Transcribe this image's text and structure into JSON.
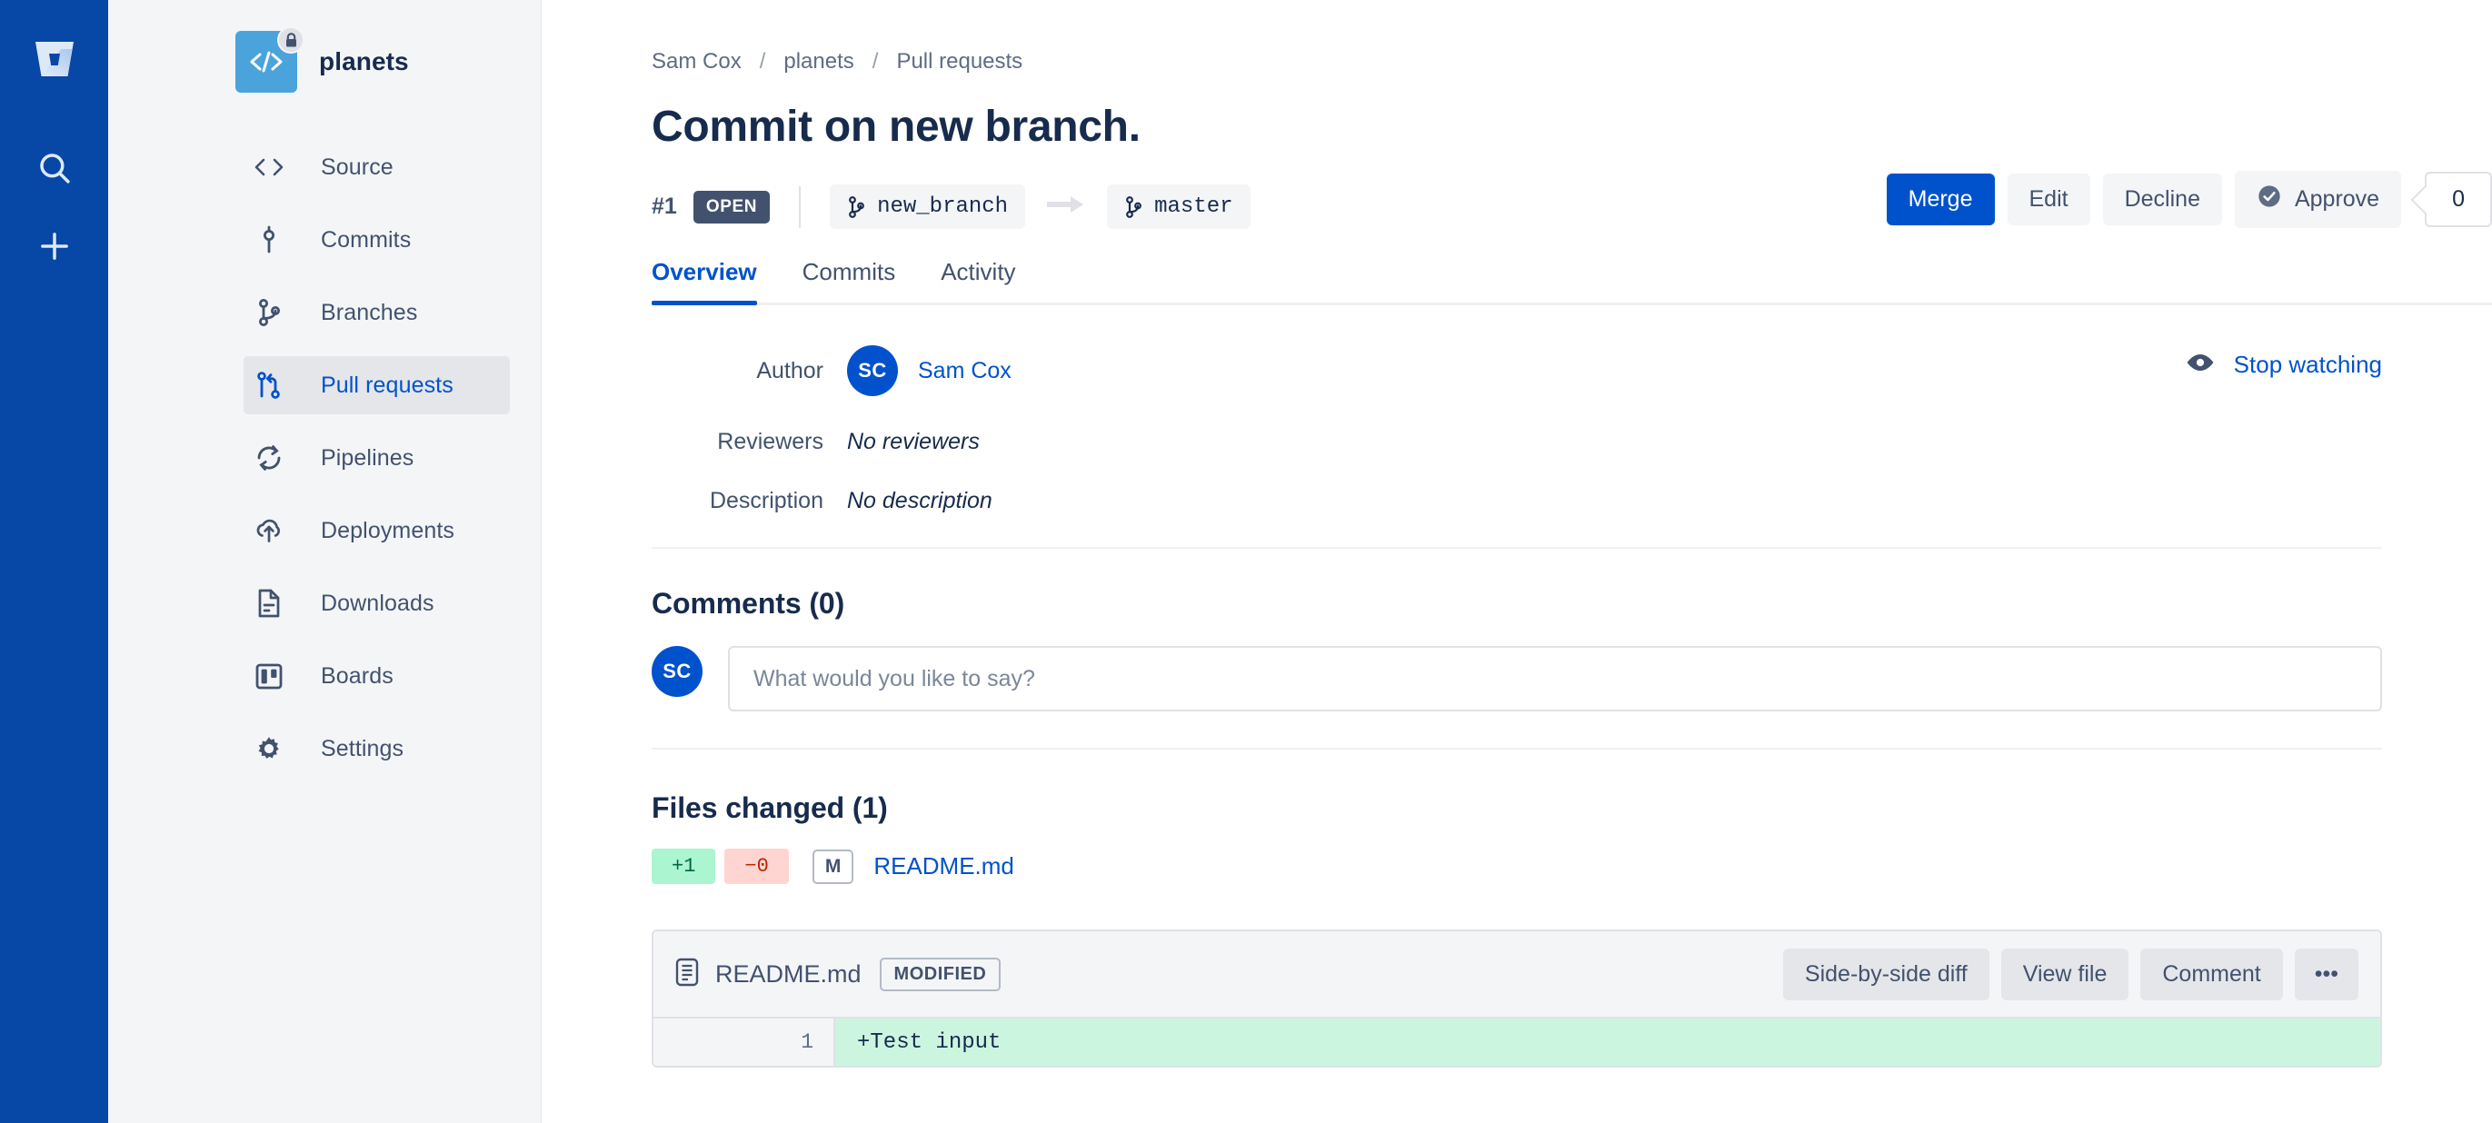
{
  "global_rail": {
    "items": [
      {
        "name": "bitbucket-logo-icon",
        "label": "Bitbucket"
      },
      {
        "name": "search-icon",
        "label": "Search"
      },
      {
        "name": "create-icon",
        "label": "Create"
      }
    ]
  },
  "sidebar": {
    "repo_name": "planets",
    "repo_avatar_glyph": "</>",
    "repo_access_icon": "lock-icon",
    "items": [
      {
        "label": "Source",
        "icon": "code-icon",
        "active": false
      },
      {
        "label": "Commits",
        "icon": "commit-icon",
        "active": false
      },
      {
        "label": "Branches",
        "icon": "branch-icon",
        "active": false
      },
      {
        "label": "Pull requests",
        "icon": "pull-request-icon",
        "active": true
      },
      {
        "label": "Pipelines",
        "icon": "pipelines-icon",
        "active": false
      },
      {
        "label": "Deployments",
        "icon": "deployments-cloud-icon",
        "active": false
      },
      {
        "label": "Downloads",
        "icon": "downloads-file-icon",
        "active": false
      },
      {
        "label": "Boards",
        "icon": "boards-icon",
        "active": false
      },
      {
        "label": "Settings",
        "icon": "gear-icon",
        "active": false
      }
    ]
  },
  "breadcrumb": {
    "items": [
      "Sam Cox",
      "planets",
      "Pull requests"
    ],
    "separator": "/"
  },
  "pull_request": {
    "title": "Commit on new branch.",
    "id": "#1",
    "state": "OPEN",
    "source_branch": "new_branch",
    "destination_branch": "master",
    "actions": {
      "merge": "Merge",
      "edit": "Edit",
      "decline": "Decline",
      "approve": "Approve",
      "approve_count": "0"
    }
  },
  "tabs": [
    {
      "label": "Overview",
      "active": true
    },
    {
      "label": "Commits",
      "active": false
    },
    {
      "label": "Activity",
      "active": false
    }
  ],
  "meta": {
    "author_label": "Author",
    "author_initials": "SC",
    "author_name": "Sam Cox",
    "reviewers_label": "Reviewers",
    "reviewers_value": "No reviewers",
    "description_label": "Description",
    "description_value": "No description",
    "watch_label": "Stop watching",
    "watch_icon": "eye-icon"
  },
  "comments": {
    "heading": "Comments (0)",
    "avatar_initials": "SC",
    "input_placeholder": "What would you like to say?",
    "input_value": ""
  },
  "files_changed": {
    "heading": "Files changed (1)",
    "additions": "+1",
    "deletions": "−0",
    "status_letter": "M",
    "file_name": "README.md"
  },
  "diff": {
    "file_name": "README.md",
    "status_badge": "MODIFIED",
    "actions": {
      "side_by_side": "Side-by-side diff",
      "view_file": "View file",
      "comment": "Comment",
      "more": "•••"
    },
    "lines": [
      {
        "number": "1",
        "text": "+Test input",
        "type": "added"
      }
    ]
  },
  "colors": {
    "brand_blue": "#0052CC",
    "rail_blue": "#0747A6",
    "sidebar_bg": "#F4F5F7",
    "text_dark": "#172B4D",
    "text_muted": "#42526E",
    "added_bg": "#CCF5DF",
    "add_badge": "#ABF5D1",
    "del_badge": "#FFD5D2"
  }
}
